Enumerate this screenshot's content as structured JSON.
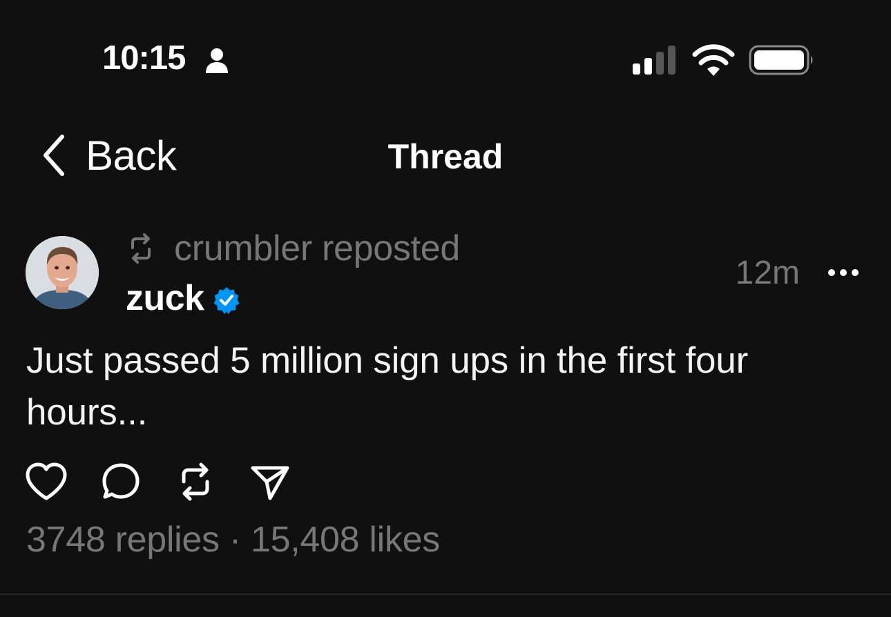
{
  "status_bar": {
    "time": "10:15",
    "person_icon": "person-icon",
    "signal_icon": "cellular-signal-icon",
    "wifi_icon": "wifi-icon",
    "battery_icon": "battery-icon"
  },
  "nav": {
    "back_label": "Back",
    "title": "Thread"
  },
  "post": {
    "repost_text": "crumbler reposted",
    "username": "zuck",
    "verified": true,
    "timestamp": "12m",
    "text": "Just passed 5 million sign ups in the first four hours...",
    "actions": [
      "heart-icon",
      "comment-icon",
      "repost-icon",
      "share-icon"
    ],
    "replies": "3748 replies",
    "separator": " · ",
    "likes": "15,408 likes"
  },
  "colors": {
    "background": "#101010",
    "text_primary": "#f3f5f7",
    "text_secondary": "#777777",
    "verified_blue": "#0095f6"
  }
}
